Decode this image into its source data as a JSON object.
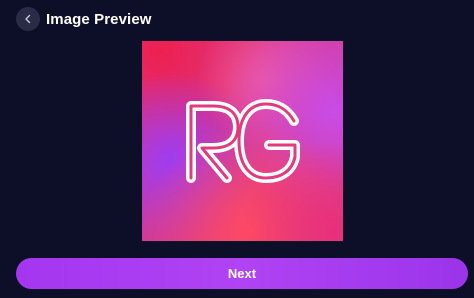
{
  "header": {
    "back_icon": "chevron-left-icon",
    "title": "Image Preview"
  },
  "preview": {
    "logo_text": "RG",
    "colors": {
      "red": "#f0264a",
      "pink": "#ff4f8a",
      "purple": "#a94cf7",
      "magenta": "#d93ddb",
      "stroke": "#ffffff"
    }
  },
  "footer": {
    "next_label": "Next",
    "accent": "#a63ff2"
  }
}
